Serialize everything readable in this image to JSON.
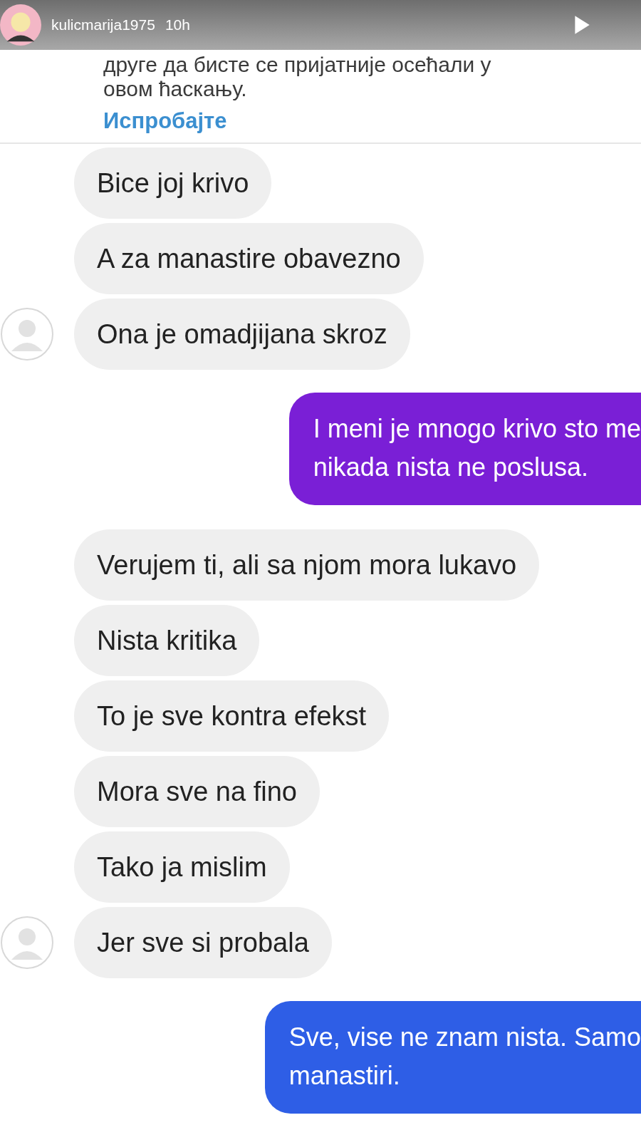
{
  "story": {
    "username": "kulicmarija1975",
    "time": "10h"
  },
  "prompt": {
    "lines": [
      "друге да бисте се пријатније осећали у",
      "овом ћаскању."
    ],
    "link": "Испробајте"
  },
  "groups": [
    {
      "kind": "incoming",
      "messages": [
        "Bice joj krivo",
        "A za manastire obavezno",
        "Ona je omadjijana skroz"
      ]
    },
    {
      "kind": "outgoing",
      "color": "#7a1fd6",
      "lines": [
        "I meni je mnogo krivo sto me",
        "nikada nista ne poslusa."
      ]
    },
    {
      "kind": "incoming",
      "messages": [
        "Verujem ti, ali sa njom mora lukavo",
        "Nista kritika",
        "To je sve kontra efekst",
        "Mora sve na fino",
        "Tako ja mislim",
        "Jer sve si probala"
      ]
    },
    {
      "kind": "outgoing",
      "color": "#2e5ee6",
      "lines": [
        "Sve, vise ne znam nista. Samo",
        "manastiri."
      ]
    }
  ]
}
